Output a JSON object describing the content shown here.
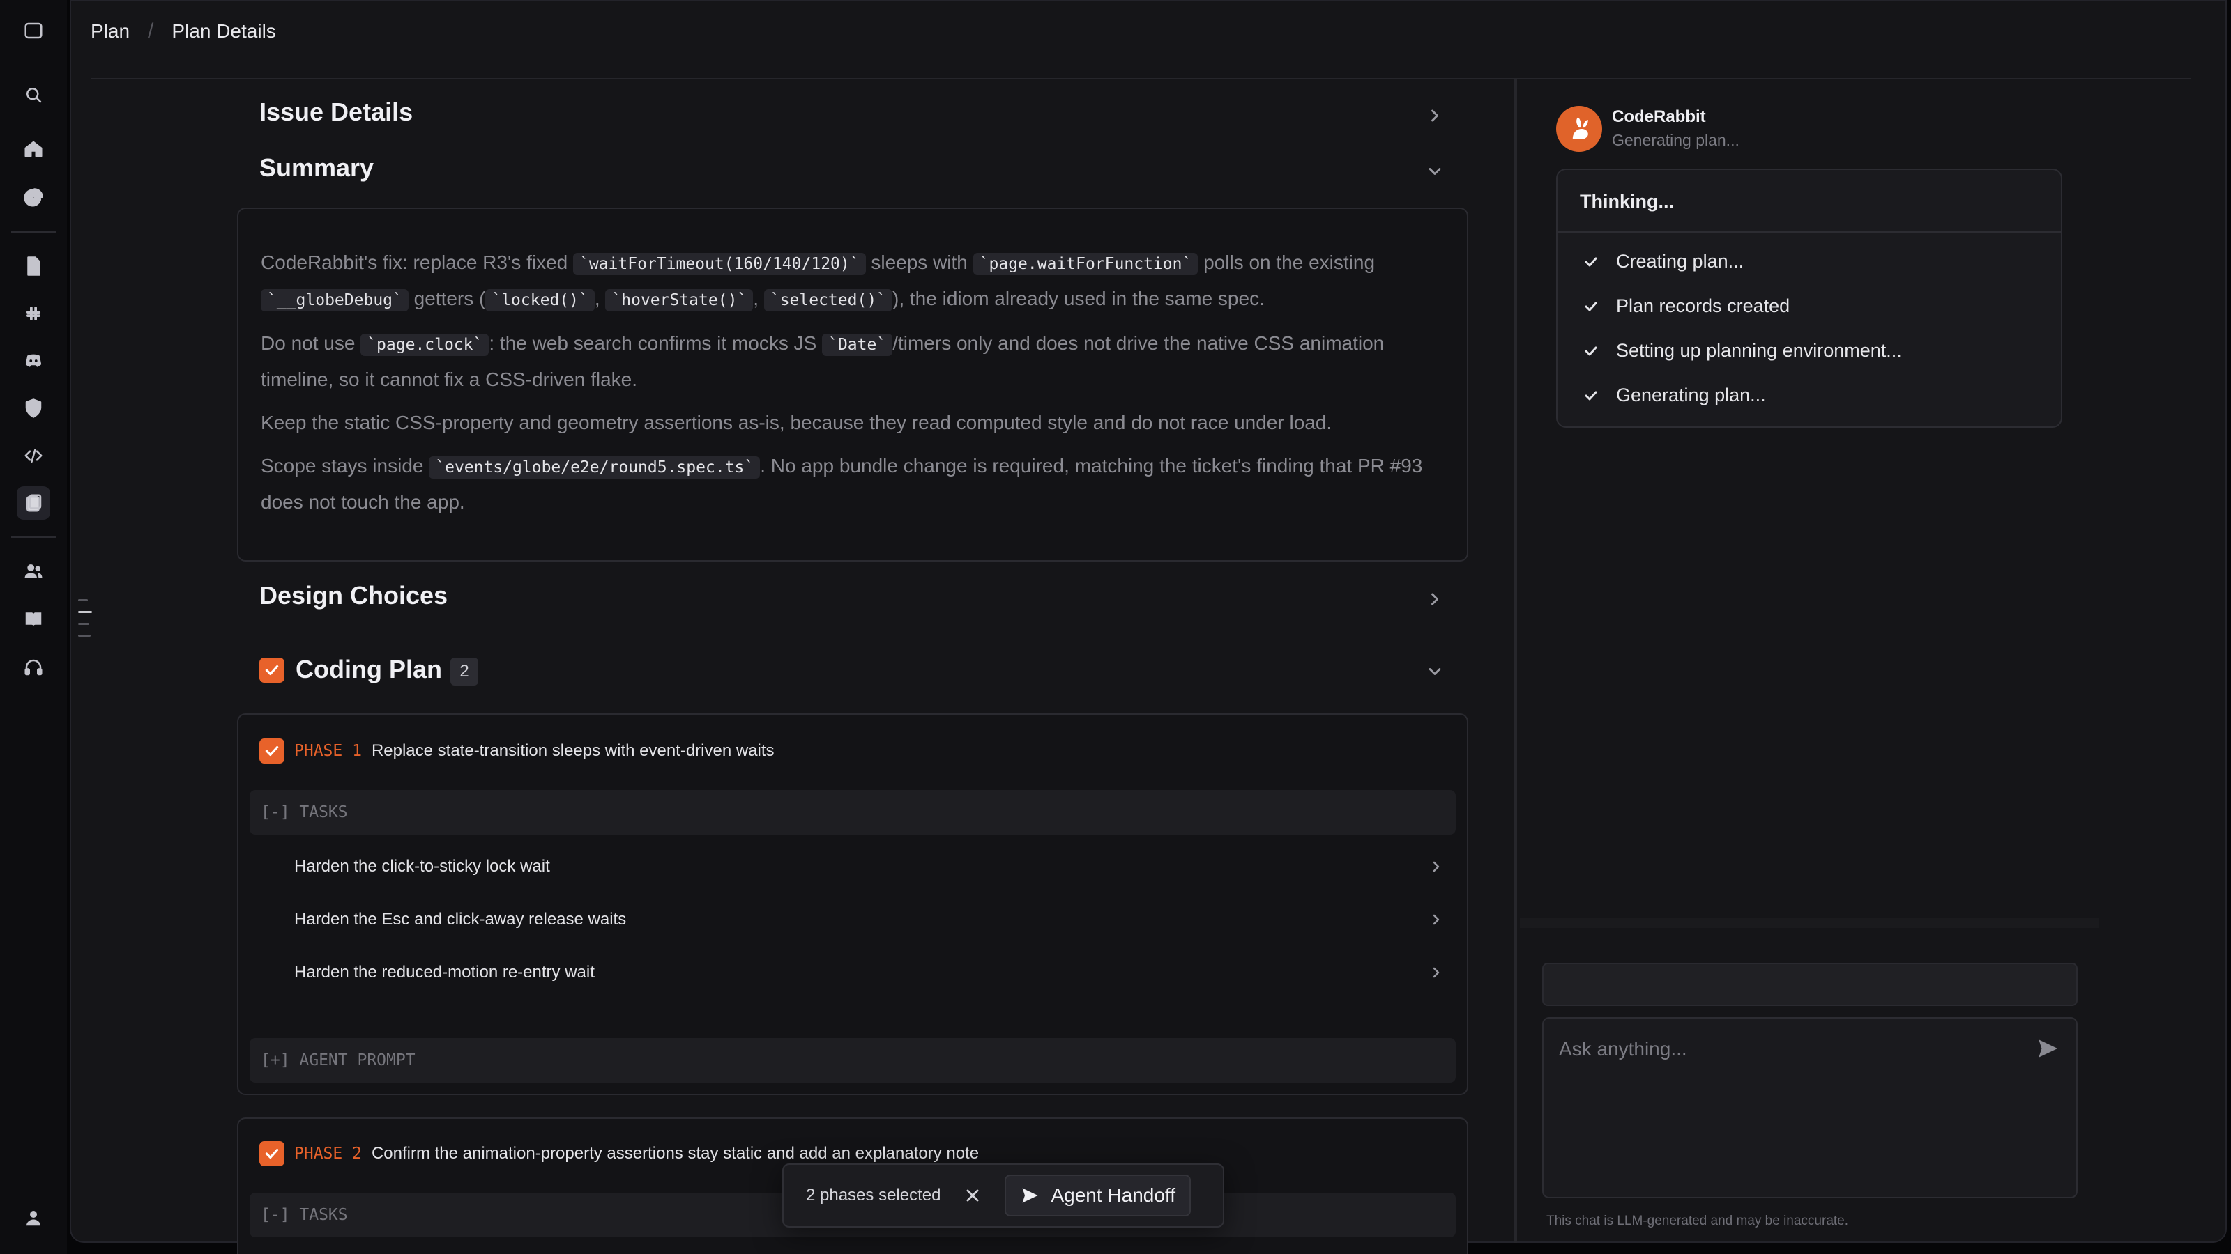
{
  "breadcrumb": {
    "root": "Plan",
    "separator": "/",
    "current": "Plan Details"
  },
  "sections": {
    "issue_details": "Issue Details",
    "summary": "Summary",
    "design_choices": "Design Choices",
    "coding_plan": "Coding Plan",
    "coding_plan_count": "2"
  },
  "summary": {
    "p1": {
      "t1": "CodeRabbit's fix: replace R3's fixed ",
      "c1": "`waitForTimeout(160/140/120)`",
      "t2": " sleeps with ",
      "c2": "`page.waitForFunction`",
      "t3": " polls on the existing ",
      "c3": "`__globeDebug`",
      "t4": " getters (",
      "c4": "`locked()`",
      "t5": ", ",
      "c5": "`hoverState()`",
      "t6": ", ",
      "c6": "`selected()`",
      "t7": "), the idiom already used in the same spec."
    },
    "p2": {
      "t1": "Do not use ",
      "c1": "`page.clock`",
      "t2": ": the web search confirms it mocks JS ",
      "c2": "`Date`",
      "t3": "/timers only and does not drive the native CSS animation timeline, so it cannot fix a CSS-driven flake."
    },
    "p3": "Keep the static CSS-property and geometry assertions as-is, because they read computed style and do not race under load.",
    "p4": {
      "t1": "Scope stays inside ",
      "c1": "`events/globe/e2e/round5.spec.ts`",
      "t2": ". No app bundle change is required, matching the ticket's finding that PR #93 does not touch the app."
    }
  },
  "phases": [
    {
      "label": "PHASE 1",
      "title": "Replace state-transition sleeps with event-driven waits",
      "checked": true,
      "tasks_header": "[-] TASKS",
      "tasks": [
        "Harden the click-to-sticky lock wait",
        "Harden the Esc and click-away release waits",
        "Harden the reduced-motion re-entry wait"
      ],
      "agent_prompt": "[+] AGENT PROMPT"
    },
    {
      "label": "PHASE 2",
      "title": "Confirm the animation-property assertions stay static and add an explanatory note",
      "checked": true,
      "tasks_header": "[-] TASKS"
    }
  ],
  "floating_bar": {
    "selected": "2 phases selected",
    "handoff": "Agent Handoff"
  },
  "assistant": {
    "name": "CodeRabbit",
    "status": "Generating plan...",
    "thinking_title": "Thinking...",
    "steps": [
      "Creating plan...",
      "Plan records created",
      "Setting up planning environment...",
      "Generating plan..."
    ],
    "input_placeholder": "Ask anything...",
    "disclaimer": "This chat is LLM-generated and may be inaccurate."
  },
  "colors": {
    "accent": "#e8622a",
    "background": "#151518",
    "sidebar": "#0d0d10"
  },
  "icons": {
    "sidebar": [
      "panel-toggle-icon",
      "search-icon",
      "home-icon",
      "pie-chart-icon",
      "document-icon",
      "slack-icon",
      "discord-icon",
      "shield-icon",
      "code-icon",
      "clipboard-icon",
      "users-icon",
      "book-icon",
      "headset-icon",
      "user-avatar-icon"
    ]
  }
}
